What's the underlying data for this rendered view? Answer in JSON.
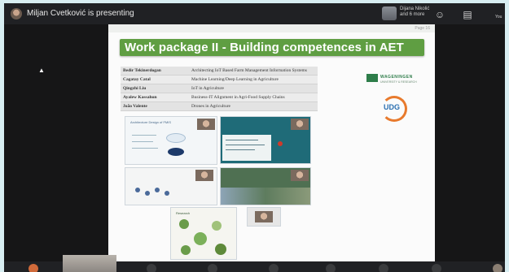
{
  "meeting": {
    "presenter_text": "Miljan Cvetković is presenting",
    "participant_name": "Dijana Nikolić",
    "participant_extra": "and 6 more",
    "tool_label": "You"
  },
  "slide": {
    "page_number": "Page 16",
    "title": "Work package II - Building competences in AET",
    "table": [
      {
        "name": "Bedir Tekinerdogan",
        "topic": "Architecting IoT Based Farm Management Information Systems"
      },
      {
        "name": "Cagatay Catal",
        "topic": "Machine Learning/Deep Learning in Agriculture"
      },
      {
        "name": "Qingzhi Liu",
        "topic": "IoT in Agriculture"
      },
      {
        "name": "Ayalew Kassahun",
        "topic": "Business-IT Alignment in Agri-Food Supply Chains"
      },
      {
        "name": "João Valente",
        "topic": "Drones in Agriculture"
      }
    ],
    "logos": {
      "wur": "WAGENINGEN",
      "wur_sub": "UNIVERSITY & RESEARCH",
      "udg": "UDG"
    },
    "thumb_labels": {
      "th1": "Architecture Design of FMIS",
      "th5": "Research"
    }
  },
  "colors": {
    "title_green": "#5f9e42",
    "frame_bg": "#1e1f20"
  }
}
